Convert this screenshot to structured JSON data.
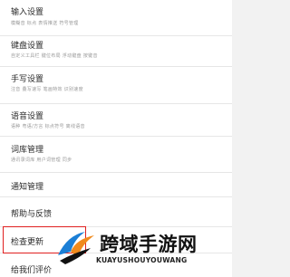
{
  "settings": {
    "items": [
      {
        "title": "输入设置",
        "subtitle": "模糊音 标点 表情推送 符号管理"
      },
      {
        "title": "键盘设置",
        "subtitle": "自定义工具栏 键位布局 浮动键盘 按键音"
      },
      {
        "title": "手写设置",
        "subtitle": "注音 叠写速写 笔画特效 识别速度"
      },
      {
        "title": "语音设置",
        "subtitle": "语种 粤语/方言 标点符号 离线语音"
      },
      {
        "title": "词库管理",
        "subtitle": "通讯录词库 用户词管理 同步"
      },
      {
        "title": "通知管理",
        "subtitle": ""
      },
      {
        "title": "帮助与反馈",
        "subtitle": ""
      },
      {
        "title": "检查更新",
        "subtitle": ""
      },
      {
        "title": "给我们评价",
        "subtitle": ""
      }
    ]
  },
  "watermark": {
    "cn": "跨域手游网",
    "en": "KUAYUSHOUYOUWANG",
    "colors": {
      "blue": "#1b7fd6",
      "orange": "#f08a1c",
      "dark": "#111111"
    }
  },
  "highlight_color": "#e02020"
}
